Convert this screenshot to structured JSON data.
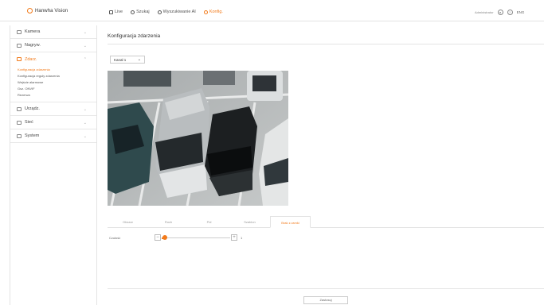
{
  "header": {
    "logo_text": "Hanwha Vision",
    "nav": [
      {
        "label": "Live",
        "icon": "monitor-icon",
        "active": false
      },
      {
        "label": "Szukaj",
        "icon": "search-icon",
        "active": false
      },
      {
        "label": "Wyszukiwanie AI",
        "icon": "ai-search-icon",
        "active": false
      },
      {
        "label": "Konfig.",
        "icon": "gear-icon",
        "active": true
      }
    ],
    "user": "Administrator",
    "help_glyph": "?",
    "lang": "ENG"
  },
  "sidebar": {
    "items": [
      {
        "label": "Kamera",
        "icon": "camera-icon"
      },
      {
        "label": "Nagryw.",
        "icon": "record-icon"
      },
      {
        "label": "Zdarz.",
        "icon": "event-icon",
        "active": true,
        "sub": [
          {
            "label": "Konfiguracja zdarzenia",
            "active": true
          },
          {
            "label": "Konfiguracja reguły zdarzenia",
            "active": false
          },
          {
            "label": "Wejście alarmowe",
            "active": false
          },
          {
            "label": "Gsz. ONVIF",
            "active": false
          },
          {
            "label": "Rezerwa",
            "active": false
          }
        ]
      },
      {
        "label": "Urządz.",
        "icon": "device-icon"
      },
      {
        "label": "Sieć",
        "icon": "network-icon"
      },
      {
        "label": "System",
        "icon": "system-icon"
      }
    ]
  },
  "main": {
    "title": "Konfiguracja zdarzenia",
    "channel_select": "Kanał 1",
    "tabs": [
      "Obszar",
      "Ruch",
      "Pół",
      "Szablon",
      "Brak z-ramki"
    ],
    "active_tab": 4,
    "slider": {
      "label": "Czułość",
      "value": 1,
      "min": 1,
      "max": 100,
      "fraction": 0.05
    },
    "apply_label": "Zastosuj"
  },
  "colors": {
    "accent": "#f27a1a"
  }
}
